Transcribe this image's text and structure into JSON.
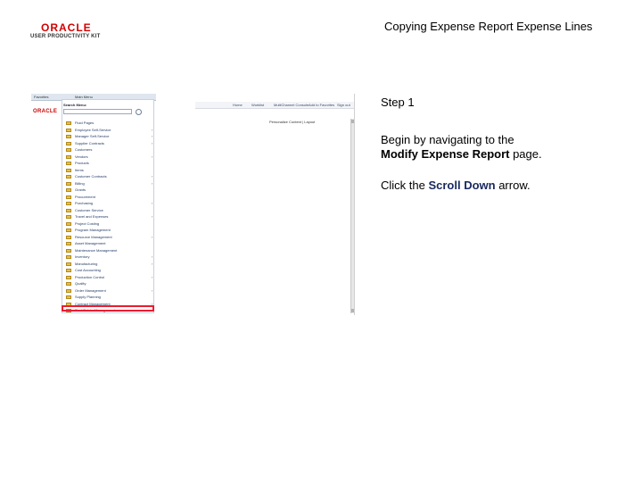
{
  "logo": {
    "brand": "ORACLE",
    "product": "USER PRODUCTIVITY KIT"
  },
  "document_title": "Copying Expense Report Expense Lines",
  "step_label": "Step 1",
  "intro": {
    "prefix": "Begin by navigating to the",
    "page_name": "Modify Expense Report",
    "suffix": " page."
  },
  "instruction": {
    "prefix": "Click the ",
    "target": "Scroll Down",
    "suffix": " arrow."
  },
  "screenshot": {
    "favorites": "Favorites",
    "main_menu": "Main Menu",
    "oracle_logo": "ORACLE",
    "nav_links": [
      "Home",
      "Worklist",
      "MultiChannel Console",
      "Add to Favorites",
      "Sign out"
    ],
    "personalize": "Personalize Content | Layout",
    "search_menu_label": "Search Menu:",
    "menu_items": [
      "Fluid Pages",
      "Employee Self-Service",
      "Manager Self-Service",
      "Supplier Contracts",
      "Customers",
      "Vendors",
      "Products",
      "Items",
      "Customer Contracts",
      "Billing",
      "Grants",
      "Procurement",
      "Purchasing",
      "Customer Service",
      "Travel and Expenses",
      "Project Costing",
      "Program Management",
      "Resource Management",
      "Asset Management",
      "Maintenance Management",
      "Inventory",
      "Manufacturing",
      "Cost Accounting",
      "Production Control",
      "Quality",
      "Order Management",
      "Supply Planning",
      "Contract Management",
      "Real Estate Management",
      "Strategic Sourcing"
    ],
    "menu_items_with_submenu": [
      1,
      2,
      3,
      5,
      8,
      9,
      12,
      14,
      17,
      20,
      21,
      23,
      25,
      27
    ]
  }
}
